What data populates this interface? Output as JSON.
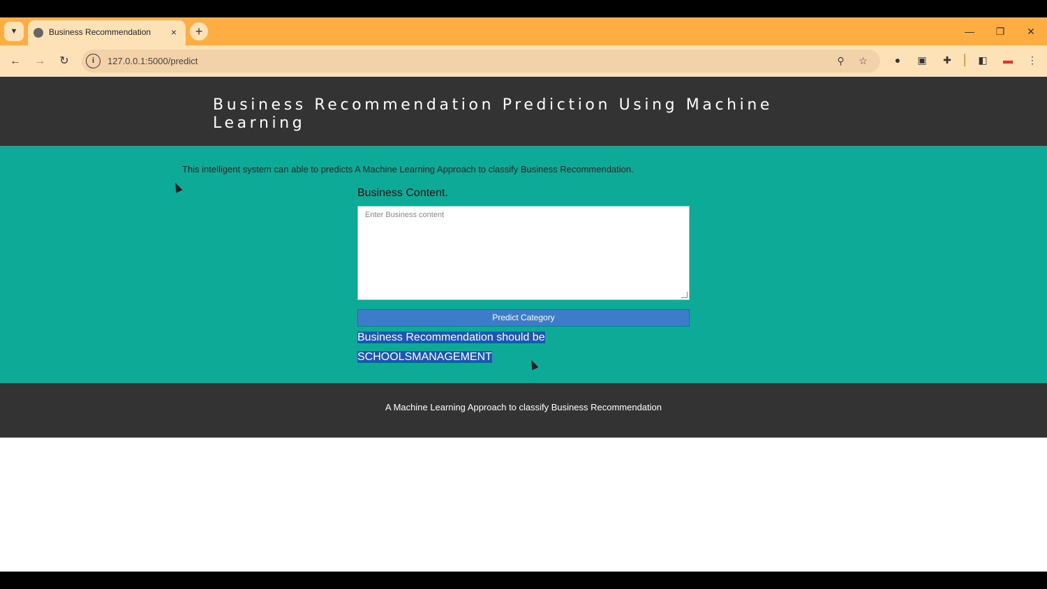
{
  "browser": {
    "tab_title": "Business Recommendation",
    "tab_close": "×",
    "newtab": "+",
    "url": "127.0.0.1:5000/predict",
    "window": {
      "minimize": "—",
      "restore": "❐",
      "close": "✕"
    }
  },
  "page": {
    "heading": "Business Recommendation Prediction Using Machine Learning",
    "intro": "This intelligent system can able to predicts A Machine Learning Approach to classify Business Recommendation.",
    "form_label": "Business Content.",
    "textarea_placeholder": "Enter Business content",
    "predict_button": "Predict Category",
    "result_line1": "Business Recommendation should be",
    "result_line2": "SCHOOLSMANAGEMENT",
    "footer": "A Machine Learning Approach to classify Business Recommendation"
  },
  "colors": {
    "tabstrip": "#fdad41",
    "header": "#333333",
    "main": "#0eaa98",
    "button": "#3d7cc8",
    "highlight": "#1a55b8"
  }
}
